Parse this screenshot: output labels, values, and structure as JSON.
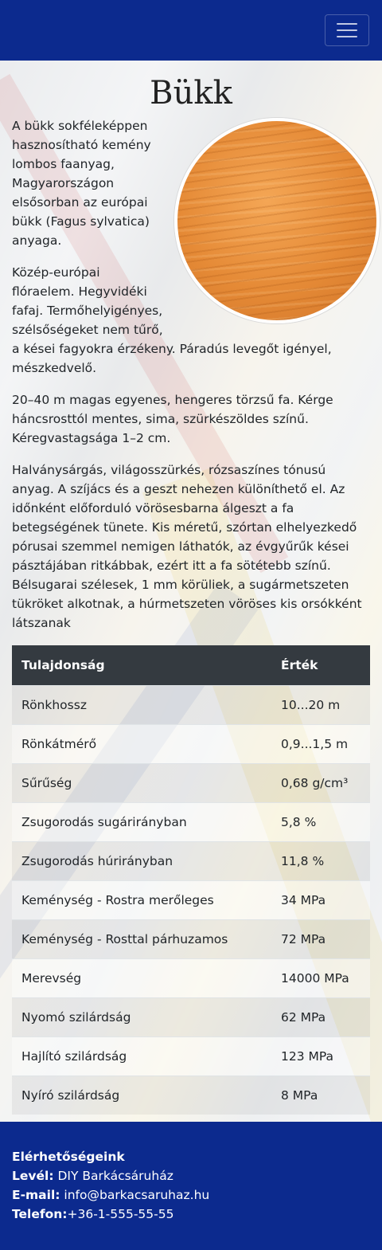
{
  "navbar": {
    "toggler_icon": "hamburger-menu-icon",
    "brand_color": "#0c2a8e"
  },
  "page": {
    "title": "Bükk",
    "paragraphs": [
      "A bükk sokféleképpen hasznosítható kemény lombos faanyag, Magyarországon elsősorban az európai bükk (Fagus sylvatica) anyaga.",
      "Közép-európai flóraelem. Hegyvidéki fafaj. Termőhelyigényes, szélsőségeket nem tűrő, a kései fagyokra érzékeny. Páradús levegőt igényel, mészkedvelő.",
      "20–40 m magas egyenes, hengeres törzsű fa. Kérge háncsrosttól mentes, sima, szürkészöldes színű. Kéregvastagsága 1–2 cm.",
      "Halványsárgás, világosszürkés, rózsaszínes tónusú anyag. A szíjács és a geszt nehezen különíthető el. Az időnként előforduló vörösesbarna álgeszt a fa betegségének tünete. Kis méretű, szórtan elhelyezkedő pórusai szemmel nemigen láthatók, az évgyűrűk kései pásztájában ritkábbak, ezért itt a fa sötétebb színű. Bélsugarai szélesek, 1 mm körüliek, a sugármetszeten tükröket alkotnak, a húrmetszeten vöröses kis orsókként látszanak"
    ]
  },
  "table": {
    "headers": [
      "Tulajdonság",
      "Érték"
    ],
    "rows": [
      [
        "Rönkhossz",
        "10...20 m"
      ],
      [
        "Rönkátmérő",
        "0,9...1,5 m"
      ],
      [
        "Sűrűség",
        "0,68 g/cm³"
      ],
      [
        "Zsugorodás sugárirányban",
        "5,8 %"
      ],
      [
        "Zsugorodás húrirányban",
        "11,8 %"
      ],
      [
        "Keménység - Rostra merőleges",
        "34 MPa"
      ],
      [
        "Keménység - Rosttal párhuzamos",
        "72 MPa"
      ],
      [
        "Merevség",
        "14000 MPa"
      ],
      [
        "Nyomó szilárdság",
        "62 MPa"
      ],
      [
        "Hajlító szilárdság",
        "123 MPa"
      ],
      [
        "Nyíró szilárdság",
        "8 MPa"
      ]
    ]
  },
  "footer": {
    "heading": "Elérhetőségeink",
    "mail_label": "Levél:",
    "mail_value": "DIY Barkácsáruház",
    "email_label": "E-mail:",
    "email_value": "info@barkacsaruhaz.hu",
    "phone_label": "Telefon:",
    "phone_value": "+36-1-555-55-55"
  }
}
